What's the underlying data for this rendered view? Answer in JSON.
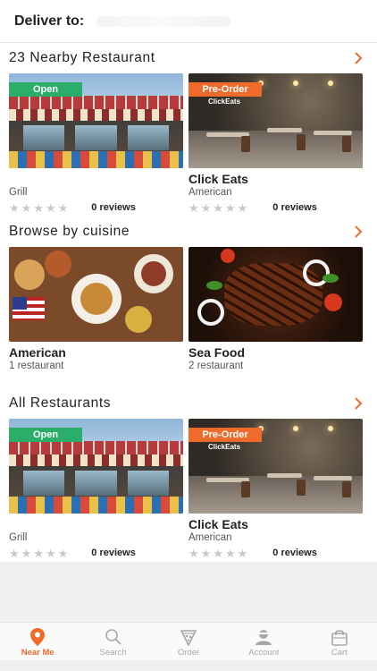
{
  "header": {
    "deliver_label": "Deliver to:"
  },
  "nearby": {
    "title": "23 Nearby Restaurant",
    "cards": [
      {
        "badge": "Open",
        "name": "",
        "subtitle": "Grill",
        "reviews": "0 reviews"
      },
      {
        "badge": "Pre-Order",
        "name": "Click Eats",
        "subtitle": "American",
        "reviews": "0 reviews",
        "logo_text": "ClickEats"
      }
    ]
  },
  "cuisine": {
    "title": "Browse by cuisine",
    "cards": [
      {
        "name": "American",
        "count": "1 restaurant"
      },
      {
        "name": "Sea Food",
        "count": "2 restaurant"
      }
    ]
  },
  "all_restaurants": {
    "title": "All Restaurants",
    "cards": [
      {
        "badge": "Open",
        "name": "",
        "subtitle": "Grill",
        "reviews": "0 reviews"
      },
      {
        "badge": "Pre-Order",
        "name": "Click Eats",
        "subtitle": "American",
        "reviews": "0 reviews",
        "logo_text": "ClickEats"
      }
    ]
  },
  "tabbar": {
    "tabs": [
      {
        "label": "Near Me",
        "icon": "location-pin-icon",
        "active": true
      },
      {
        "label": "Search",
        "icon": "search-icon",
        "active": false
      },
      {
        "label": "Order",
        "icon": "pizza-slice-icon",
        "active": false
      },
      {
        "label": "Account",
        "icon": "account-icon",
        "active": false
      },
      {
        "label": "Cart",
        "icon": "shopping-bag-icon",
        "active": false
      }
    ]
  },
  "colors": {
    "accent": "#ef6a2b",
    "open_badge": "#2cae6b",
    "tab_inactive": "#a8a8a8"
  }
}
